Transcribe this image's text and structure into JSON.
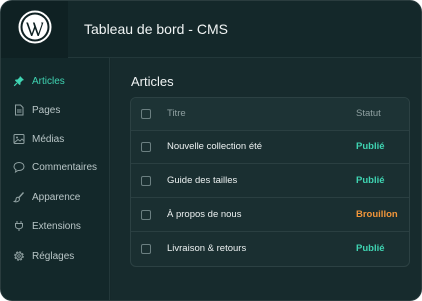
{
  "header": {
    "title": "Tableau de bord - CMS",
    "logo_icon": "wordpress-icon"
  },
  "sidebar": {
    "items": [
      {
        "label": "Articles",
        "icon": "pin-icon",
        "active": true
      },
      {
        "label": "Pages",
        "icon": "page-icon",
        "active": false
      },
      {
        "label": "Médias",
        "icon": "image-icon",
        "active": false
      },
      {
        "label": "Commentaires",
        "icon": "comment-icon",
        "active": false
      },
      {
        "label": "Apparence",
        "icon": "brush-icon",
        "active": false
      },
      {
        "label": "Extensions",
        "icon": "plugin-icon",
        "active": false
      },
      {
        "label": "Réglages",
        "icon": "gear-icon",
        "active": false
      }
    ]
  },
  "main": {
    "title": "Articles",
    "table": {
      "columns": [
        "Titre",
        "Statut"
      ],
      "rows": [
        {
          "title": "Nouvelle collection été",
          "status": "Publié"
        },
        {
          "title": "Guide des tailles",
          "status": "Publié"
        },
        {
          "title": "À propos de nous",
          "status": "Brouillon"
        },
        {
          "title": "Livraison & retours",
          "status": "Publié"
        }
      ]
    }
  },
  "colors": {
    "accent": "#3fd4b2",
    "draft": "#f0953a",
    "background": "#16292b"
  }
}
